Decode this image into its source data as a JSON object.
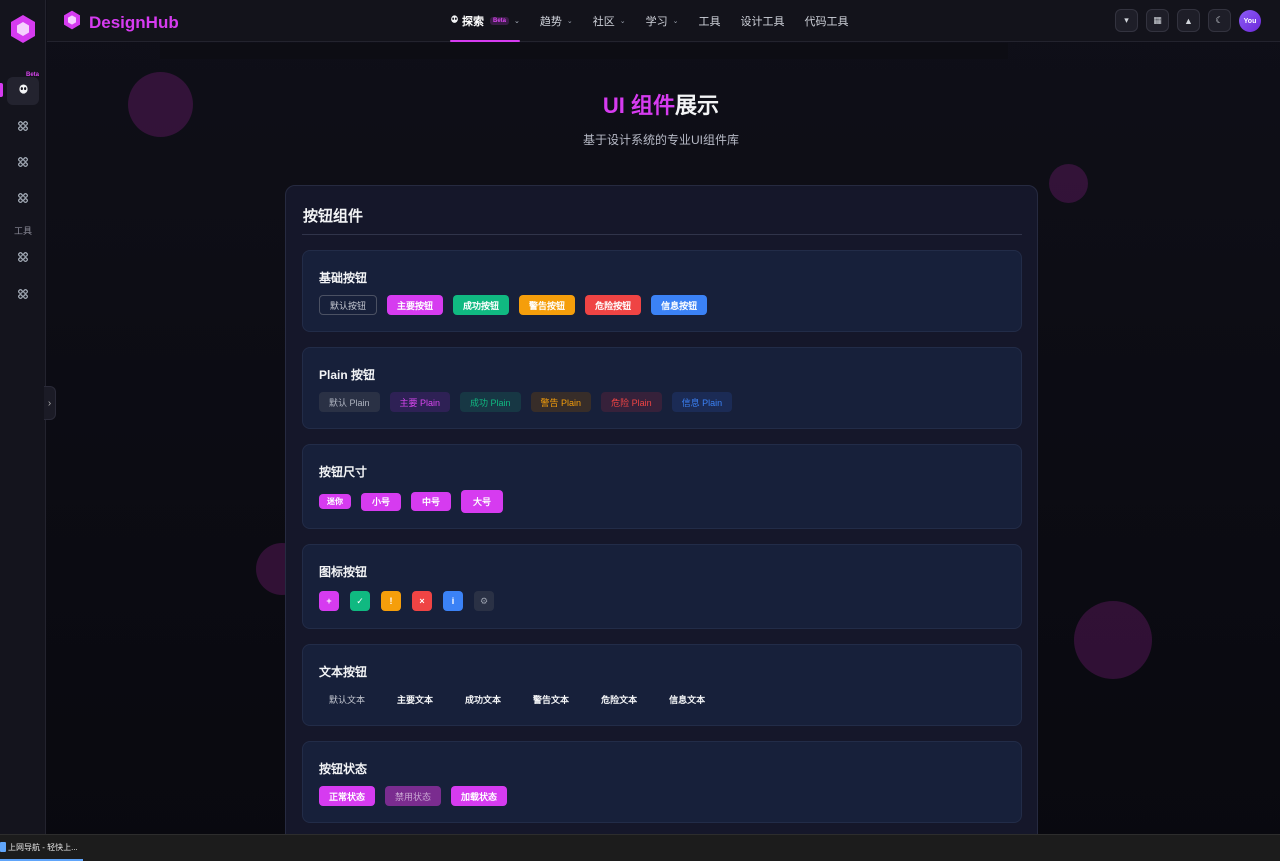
{
  "brand": {
    "name": "DesignHub"
  },
  "nav": {
    "items": [
      {
        "label": "探索",
        "badge": "Beta",
        "has_menu": true,
        "active": true
      },
      {
        "label": "趋势",
        "has_menu": true
      },
      {
        "label": "社区",
        "has_menu": true
      },
      {
        "label": "学习",
        "has_menu": true
      },
      {
        "label": "工具"
      },
      {
        "label": "设计工具"
      },
      {
        "label": "代码工具"
      }
    ]
  },
  "actions": {
    "avatar_label": "You"
  },
  "sidebar": {
    "beta_badge": "Beta",
    "tools_label": "工具"
  },
  "hero": {
    "title_a": "UI 组件",
    "title_b": "展示",
    "subtitle": "基于设计系统的专业UI组件库"
  },
  "panel": {
    "title": "按钮组件"
  },
  "sections": {
    "basic": {
      "title": "基础按钮",
      "buttons": [
        "默认按钮",
        "主要按钮",
        "成功按钮",
        "警告按钮",
        "危险按钮",
        "信息按钮"
      ]
    },
    "plain": {
      "title": "Plain 按钮",
      "buttons": [
        "默认 Plain",
        "主要 Plain",
        "成功 Plain",
        "警告 Plain",
        "危险 Plain",
        "信息 Plain"
      ]
    },
    "sizes": {
      "title": "按钮尺寸",
      "buttons": [
        "迷你",
        "小号",
        "中号",
        "大号"
      ]
    },
    "icons": {
      "title": "图标按钮",
      "glyphs": [
        "+",
        "✓",
        "!",
        "×",
        "i",
        "⚙"
      ]
    },
    "text": {
      "title": "文本按钮",
      "buttons": [
        "默认文本",
        "主要文本",
        "成功文本",
        "警告文本",
        "危险文本",
        "信息文本"
      ]
    },
    "states": {
      "title": "按钮状态",
      "buttons": [
        "正常状态",
        "禁用状态",
        "加载状态"
      ]
    }
  },
  "taskbar": {
    "item_label": "上网导航 - 轻快上..."
  },
  "colors": {
    "accent": "#d63bf0",
    "success": "#10b981",
    "warning": "#f59e0b",
    "danger": "#ef4444",
    "info": "#3b82f6"
  }
}
